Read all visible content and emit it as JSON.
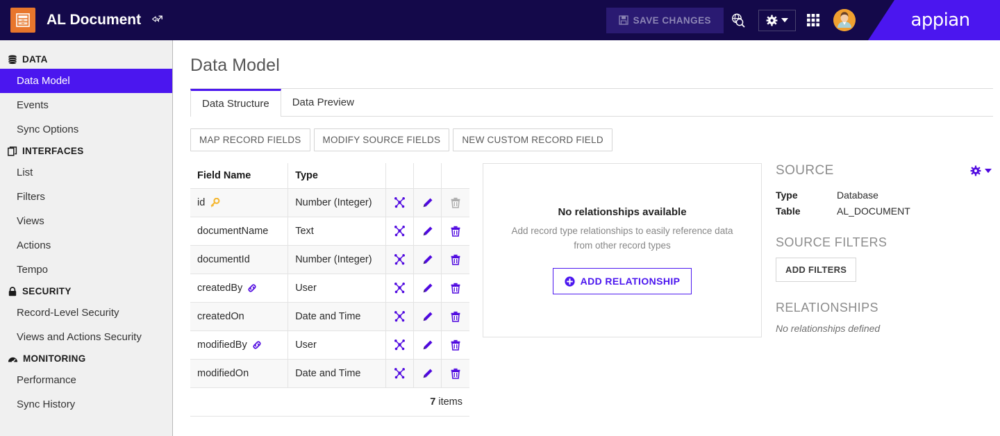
{
  "header": {
    "app_icon_name": "record-type-icon",
    "app_title": "AL Document",
    "external_link_icon": "open-in-new-icon",
    "save_label": "SAVE CHANGES",
    "save_icon": "floppy-disk-icon",
    "search_icon": "globe-search-icon",
    "settings_icon": "gear-icon",
    "settings_caret_icon": "caret-down-icon",
    "apps_icon": "app-grid-icon",
    "avatar_name": "user-avatar",
    "logo_text": "appian",
    "colors": {
      "header_bg": "#14094a",
      "brand_purple": "#4b16ef",
      "app_icon_orange": "#e8762c",
      "save_bg": "#2a1a72",
      "save_text": "#8d86b5"
    }
  },
  "sidebar": {
    "sections": [
      {
        "label": "DATA",
        "icon": "database-icon",
        "items": [
          {
            "label": "Data Model",
            "active": true
          },
          {
            "label": "Events",
            "active": false
          },
          {
            "label": "Sync Options",
            "active": false
          }
        ]
      },
      {
        "label": "INTERFACES",
        "icon": "interface-copy-icon",
        "items": [
          {
            "label": "List",
            "active": false
          },
          {
            "label": "Filters",
            "active": false
          },
          {
            "label": "Views",
            "active": false
          },
          {
            "label": "Actions",
            "active": false
          },
          {
            "label": "Tempo",
            "active": false
          }
        ]
      },
      {
        "label": "SECURITY",
        "icon": "lock-icon",
        "items": [
          {
            "label": "Record-Level Security",
            "active": false
          },
          {
            "label": "Views and Actions Security",
            "active": false
          }
        ]
      },
      {
        "label": "MONITORING",
        "icon": "gauge-icon",
        "items": [
          {
            "label": "Performance",
            "active": false
          },
          {
            "label": "Sync History",
            "active": false
          }
        ]
      }
    ]
  },
  "main": {
    "page_title": "Data Model",
    "tabs": [
      {
        "label": "Data Structure",
        "active": true
      },
      {
        "label": "Data Preview",
        "active": false
      }
    ],
    "actions": [
      {
        "label": "MAP RECORD FIELDS"
      },
      {
        "label": "MODIFY SOURCE FIELDS"
      },
      {
        "label": "NEW CUSTOM RECORD FIELD"
      }
    ],
    "table": {
      "columns": [
        "Field Name",
        "Type"
      ],
      "row_icons": {
        "relationship": "relationship-node-icon",
        "edit": "pencil-icon",
        "delete": "trash-icon"
      },
      "rows": [
        {
          "name": "id",
          "type": "Number (Integer)",
          "badge": "primary-key-icon",
          "delete_enabled": false
        },
        {
          "name": "documentName",
          "type": "Text",
          "badge": null,
          "delete_enabled": true
        },
        {
          "name": "documentId",
          "type": "Number (Integer)",
          "badge": null,
          "delete_enabled": true
        },
        {
          "name": "createdBy",
          "type": "User",
          "badge": "link-icon",
          "delete_enabled": true
        },
        {
          "name": "createdOn",
          "type": "Date and Time",
          "badge": null,
          "delete_enabled": true
        },
        {
          "name": "modifiedBy",
          "type": "User",
          "badge": "link-icon",
          "delete_enabled": true
        },
        {
          "name": "modifiedOn",
          "type": "Date and Time",
          "badge": null,
          "delete_enabled": true
        }
      ],
      "footer_count": "7",
      "footer_label": "items"
    },
    "relationships_panel": {
      "title": "No relationships available",
      "subtitle": "Add record type relationships to easily reference data from other record types",
      "button_label": "ADD RELATIONSHIP",
      "button_icon": "plus-circle-icon"
    }
  },
  "source_panel": {
    "heading": "SOURCE",
    "gear_icon": "gear-icon",
    "caret_icon": "caret-down-icon",
    "fields": [
      {
        "key": "Type",
        "value": "Database"
      },
      {
        "key": "Table",
        "value": "AL_DOCUMENT"
      }
    ],
    "filters_heading": "SOURCE FILTERS",
    "add_filters_label": "ADD FILTERS",
    "relationships_heading": "RELATIONSHIPS",
    "relationships_empty": "No relationships defined"
  }
}
